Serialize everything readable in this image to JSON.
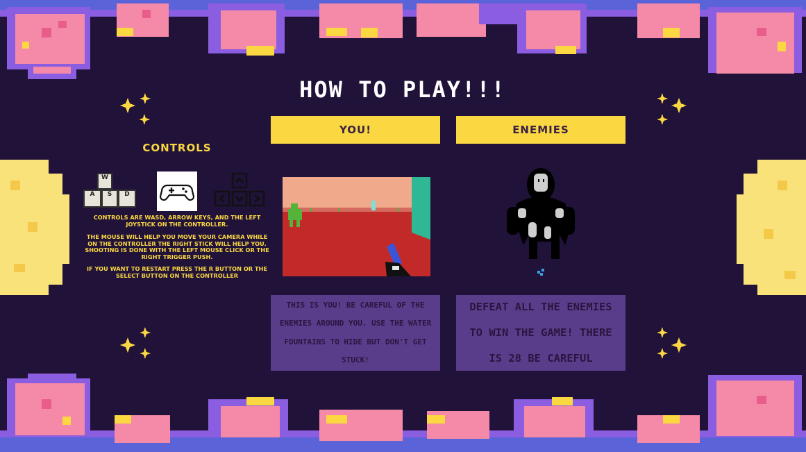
{
  "title": "HOW TO PLAY!!!",
  "tabs": {
    "you_label": "YOU!",
    "enemies_label": "ENEMiES"
  },
  "controls": {
    "heading": "CONTROLS",
    "keys": {
      "w": "W",
      "a": "A",
      "s": "S",
      "d": "D"
    },
    "text_move": "CONTROLS ARE WASD, ARROW KEYS, AND THE LEFT JOYSTICK ON THE CONTROLLER.",
    "text_camera": "THE MOUSE WILL HELP YOU MOVE YOUR CAMERA WHILE ON THE CONTROLLER THE RIGHT STICK WILL HELP YOU. SHOOTING IS DONE WITH THE LEFT MOUSE CLICK OR THE RIGHT TRIGGER PUSH.",
    "text_restart": "IF YOU WANT TO RESTART PRESS THE R BUTTON OR THE SELECT BUTTON ON THE CONTROLLER"
  },
  "you_description": "THiS iS YOU! BE CAREFUL OF THE ENEMiES AROUND YOU. USE THE WATER FOUNTAiNS TO HiDE BUT DON'T GET STUCK!",
  "enemies_description": "DEFEAT ALL THE ENEMiES TO WiN THE GAME! THERE iS 28 BE CAREFUL",
  "colors": {
    "background": "#21123a",
    "accent_yellow": "#fbd842",
    "box_purple": "#5a3d8a",
    "border_blue": "#5a63d8",
    "border_violet": "#8b5de0",
    "border_pink": "#f58aa8",
    "moon_yellow": "#f9e27a"
  },
  "icons": [
    "wasd-keys-icon",
    "gamepad-icon",
    "arrow-keys-icon",
    "sparkle-icon",
    "pixel-planet-icon",
    "pixel-moon-icon"
  ]
}
